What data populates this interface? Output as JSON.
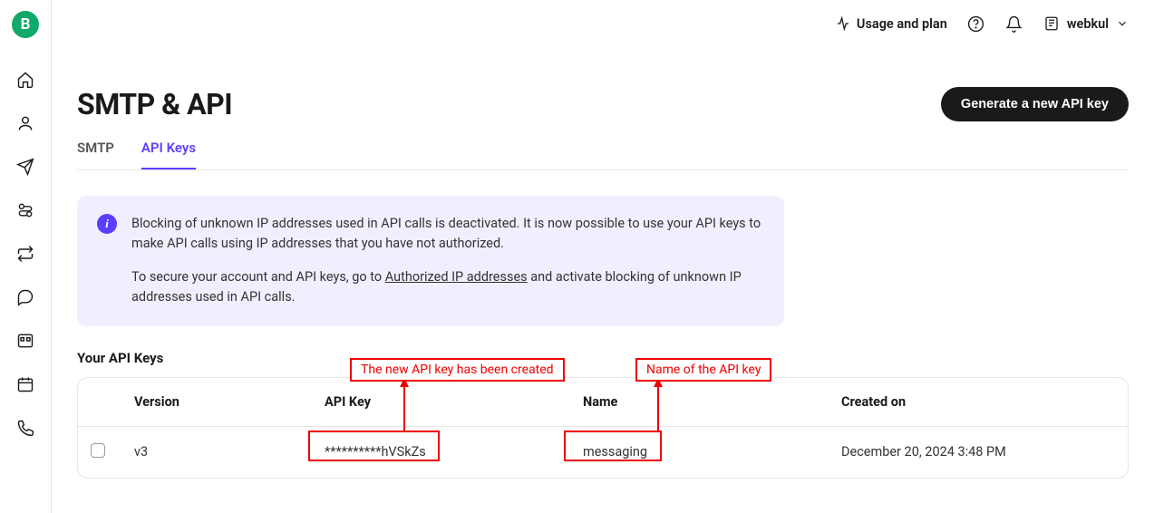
{
  "brand_letter": "B",
  "topbar": {
    "usage_label": "Usage and plan",
    "username": "webkul"
  },
  "page": {
    "title": "SMTP & API",
    "generate_button": "Generate a new API key"
  },
  "tabs": {
    "smtp": "SMTP",
    "api_keys": "API Keys"
  },
  "info": {
    "line1": "Blocking of unknown IP addresses used in API calls is deactivated. It is now possible to use your API keys to make API calls using IP addresses that you have not authorized.",
    "line2_pre": "To secure your account and API keys, go to ",
    "line2_link": "Authorized IP addresses",
    "line2_post": " and activate blocking of unknown IP addresses used in API calls."
  },
  "table": {
    "section_title": "Your API Keys",
    "head": {
      "version": "Version",
      "api_key": "API Key",
      "name": "Name",
      "created": "Created on"
    },
    "row": {
      "version": "v3",
      "api_key": "**********hVSkZs",
      "name": "messaging",
      "created": "December 20, 2024 3:48 PM"
    }
  },
  "annotations": {
    "api_key_note": "The new API key has been created",
    "name_note": "Name of the API key"
  }
}
